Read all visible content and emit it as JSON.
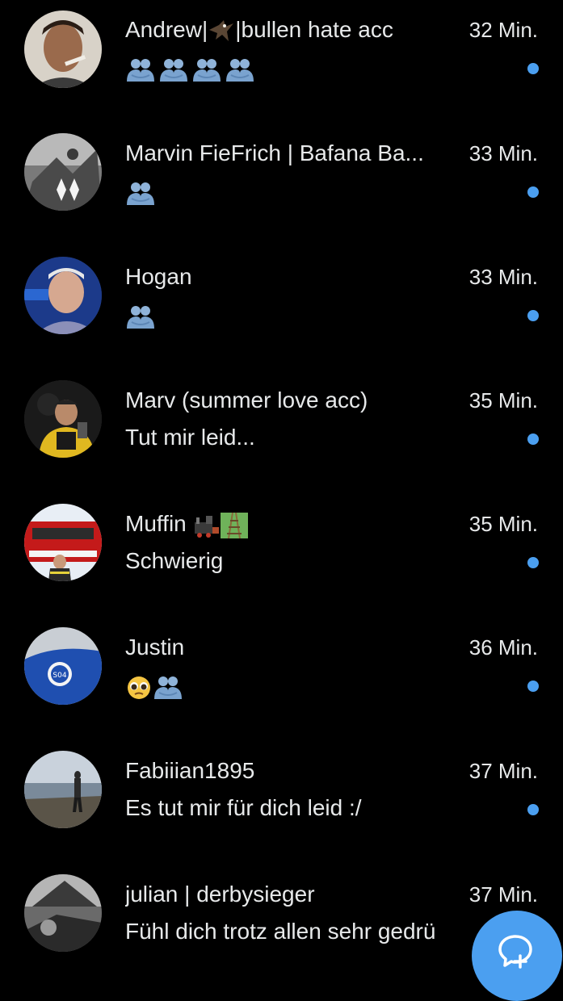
{
  "conversations": [
    {
      "name": "Andrew|",
      "name_suffix": "|bullen hate acc",
      "name_emoji": "eagle-icon",
      "time": "32 Min.",
      "preview_text": "",
      "preview_icons": [
        "hug-icon",
        "hug-icon",
        "hug-icon",
        "hug-icon"
      ],
      "unread": true
    },
    {
      "name": "Marvin FieFrich | Bafana Ba...",
      "name_suffix": "",
      "name_emoji": "",
      "time": "33 Min.",
      "preview_text": "",
      "preview_icons": [
        "hug-icon"
      ],
      "unread": true
    },
    {
      "name": "Hogan",
      "name_suffix": "",
      "name_emoji": "",
      "time": "33 Min.",
      "preview_text": "",
      "preview_icons": [
        "hug-icon"
      ],
      "unread": true
    },
    {
      "name": "Marv (summer love acc)",
      "name_suffix": "",
      "name_emoji": "",
      "time": "35 Min.",
      "preview_text": "Tut mir leid...",
      "preview_icons": [],
      "unread": true
    },
    {
      "name": "Muffin",
      "name_suffix": "",
      "name_emoji": "train-icon",
      "time": "35 Min.",
      "preview_text": "Schwierig",
      "preview_icons": [],
      "unread": true
    },
    {
      "name": "Justin",
      "name_suffix": "",
      "name_emoji": "",
      "time": "36 Min.",
      "preview_text": "",
      "preview_icons": [
        "pleading-face-icon",
        "hug-icon"
      ],
      "unread": true
    },
    {
      "name": "Fabiiian1895",
      "name_suffix": "",
      "name_emoji": "",
      "time": "37 Min.",
      "preview_text": "Es tut mir für dich leid :/",
      "preview_icons": [],
      "unread": true
    },
    {
      "name": "julian | derbysieger",
      "name_suffix": "",
      "name_emoji": "",
      "time": "37 Min.",
      "preview_text": "Fühl dich trotz allen sehr gedrü",
      "preview_icons": [],
      "unread": false
    }
  ],
  "colors": {
    "background": "#000000",
    "text": "#e7e9ea",
    "unread_dot": "#4b9ff0",
    "fab": "#4b9ff0"
  },
  "fab": {
    "icon": "new-message-icon"
  }
}
